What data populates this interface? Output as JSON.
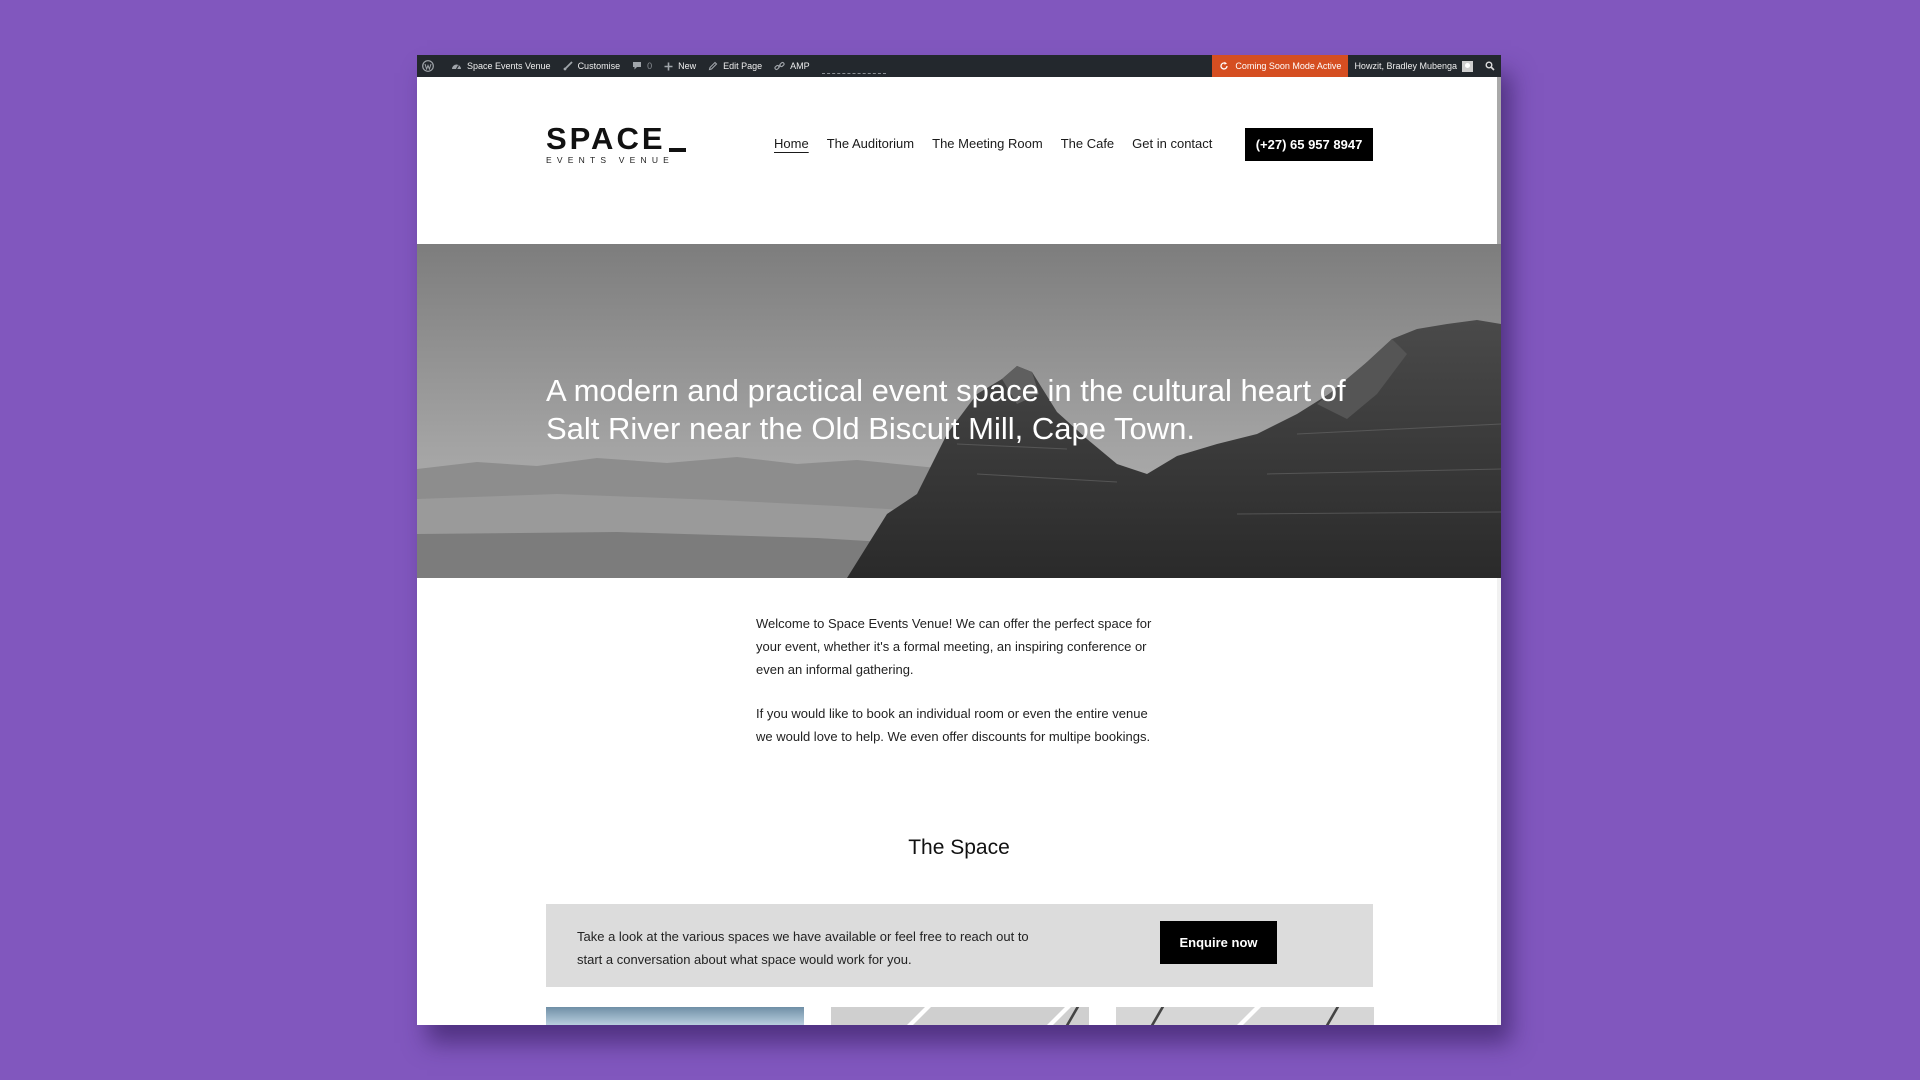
{
  "admin_bar": {
    "site_name": "Space Events Venue",
    "customise": "Customise",
    "comments_count": "0",
    "new": "New",
    "edit_page": "Edit Page",
    "amp": "AMP",
    "coming_soon": "Coming Soon Mode Active",
    "howdy": "Howzit, Bradley Mubenga"
  },
  "header": {
    "logo_main": "SPACE",
    "logo_sub": "EVENTS VENUE",
    "nav": [
      "Home",
      "The Auditorium",
      "The Meeting Room",
      "The Cafe",
      "Get in contact"
    ],
    "phone": "(+27) 65 957 8947"
  },
  "hero": {
    "headline": "A modern and practical event space in the cultural heart of Salt River near the Old Biscuit Mill, Cape Town."
  },
  "intro": {
    "p1": "Welcome to Space Events Venue! We can offer the perfect space for your event, whether it's a formal meeting, an inspiring conference or even an informal gathering.",
    "p2": "If you would like to book an individual room or even the entire venue we would love to help. We even offer discounts for multipe bookings."
  },
  "space_section": {
    "title": "The Space",
    "cta_text": "Take a look at the various spaces we have available or feel free to reach out to start a conversation about what space would work for you.",
    "cta_button": "Enquire now"
  },
  "colors": {
    "background": "#8157be",
    "admin_bar": "#23282d",
    "coming_soon": "#d54e21",
    "button": "#000000",
    "cta_box": "#dcdcdc"
  }
}
